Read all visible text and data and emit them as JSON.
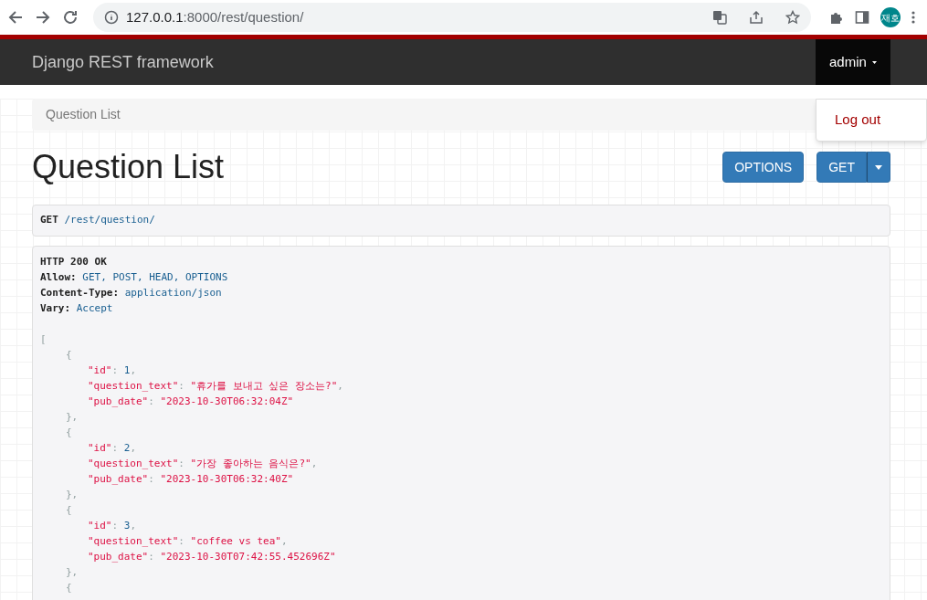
{
  "browser": {
    "url_host": "127.0.0.1",
    "url_rest": ":8000/rest/question/",
    "profile": "재호"
  },
  "navbar": {
    "brand": "Django REST framework",
    "user": "admin"
  },
  "user_menu": {
    "items": [
      "Log out"
    ]
  },
  "breadcrumb": [
    {
      "label": "Question List",
      "selected": true
    }
  ],
  "page_title": "Question List",
  "buttons": [
    {
      "label": "OPTIONS",
      "kind": "plain"
    },
    {
      "label": "GET",
      "kind": "split"
    }
  ],
  "request": {
    "method": "GET",
    "path": "/rest/question/"
  },
  "response": {
    "status": "HTTP 200 OK",
    "headers": [
      {
        "name": "Allow:",
        "value": "GET, POST, HEAD, OPTIONS"
      },
      {
        "name": "Content-Type:",
        "value": "application/json"
      },
      {
        "name": "Vary:",
        "value": "Accept"
      }
    ],
    "body": {
      "open": "[",
      "items": [
        {
          "open": "{",
          "fields": [
            {
              "key": "\"id\"",
              "colon": ": ",
              "value": "1",
              "kind": "number",
              "comma": ","
            },
            {
              "key": "\"question_text\"",
              "colon": ": ",
              "value": "\"휴가를 보내고 싶은 장소는?\"",
              "kind": "string",
              "comma": ","
            },
            {
              "key": "\"pub_date\"",
              "colon": ": ",
              "value": "\"2023-10-30T06:32:04Z\"",
              "kind": "string"
            }
          ],
          "close": "},"
        },
        {
          "open": "{",
          "fields": [
            {
              "key": "\"id\"",
              "colon": ": ",
              "value": "2",
              "kind": "number",
              "comma": ","
            },
            {
              "key": "\"question_text\"",
              "colon": ": ",
              "value": "\"가장 좋아하는 음식은?\"",
              "kind": "string",
              "comma": ","
            },
            {
              "key": "\"pub_date\"",
              "colon": ": ",
              "value": "\"2023-10-30T06:32:40Z\"",
              "kind": "string"
            }
          ],
          "close": "},"
        },
        {
          "open": "{",
          "fields": [
            {
              "key": "\"id\"",
              "colon": ": ",
              "value": "3",
              "kind": "number",
              "comma": ","
            },
            {
              "key": "\"question_text\"",
              "colon": ": ",
              "value": "\"coffee vs tea\"",
              "kind": "string",
              "comma": ","
            },
            {
              "key": "\"pub_date\"",
              "colon": ": ",
              "value": "\"2023-10-30T07:42:55.452696Z\"",
              "kind": "string"
            }
          ],
          "close": "},"
        },
        {
          "open": "{"
        }
      ]
    }
  }
}
